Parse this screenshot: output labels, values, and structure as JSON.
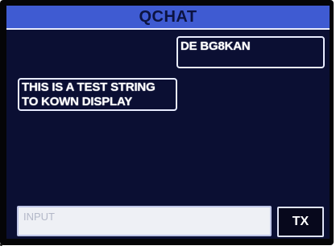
{
  "app": {
    "title": "QCHAT"
  },
  "messages": [
    {
      "direction": "outgoing",
      "lines": [
        "DE BG8KAN"
      ]
    },
    {
      "direction": "incoming",
      "lines": [
        "THIS IS A TEST STRING",
        "TO KOWN DISPLAY"
      ]
    }
  ],
  "compose": {
    "placeholder": "INPUT",
    "value": ""
  },
  "actions": {
    "transmit_label": "TX"
  },
  "colors": {
    "screen_background": "#0b0f33",
    "title_bar": "#3f5bd2",
    "bubble_border": "#e8ecff",
    "input_background": "#eef0f5"
  }
}
